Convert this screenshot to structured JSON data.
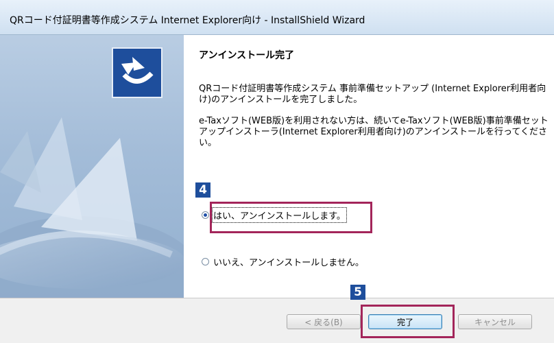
{
  "window": {
    "title": "QRコード付証明書等作成システム Internet Explorer向け - InstallShield Wizard"
  },
  "content": {
    "heading": "アンインストール完了",
    "paragraph1": "QRコード付証明書等作成システム 事前準備セットアップ (Internet Explorer利用者向け)のアンインストールを完了しました。",
    "paragraph2": "e-Taxソフト(WEB版)を利用されない方は、続いてe-Taxソフト(WEB版)事前準備セットアップインストーラ(Internet Explorer利用者向け)のアンインストールを行ってください。",
    "options": [
      {
        "label": "はい、アンインストールします。",
        "selected": true
      },
      {
        "label": "いいえ、アンインストールしません。",
        "selected": false
      }
    ]
  },
  "buttons": {
    "back": "< 戻る(B)",
    "finish": "完了",
    "cancel": "キャンセル"
  },
  "annotations": {
    "step4": "4",
    "step5": "5",
    "highlight_color": "#a3255a",
    "badge_color": "#1e4e9c"
  }
}
